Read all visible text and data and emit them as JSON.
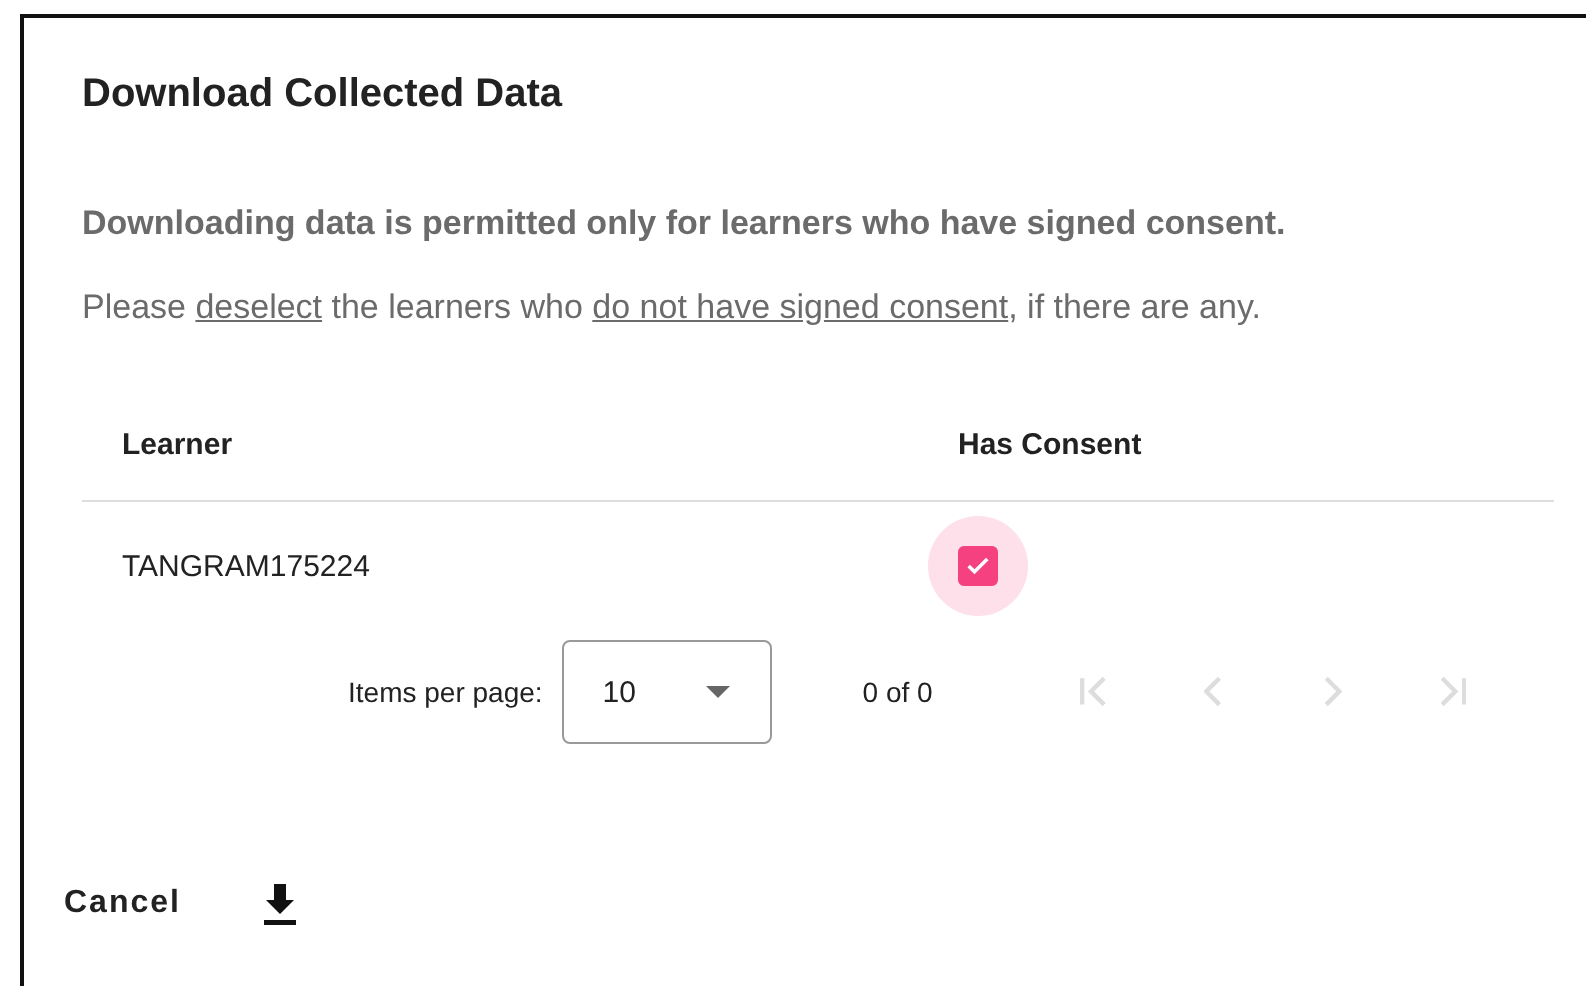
{
  "dialog": {
    "title": "Download Collected Data",
    "notice": "Downloading data is permitted only for learners who have signed consent.",
    "instruction": [
      {
        "text": "Please ",
        "underlined": false
      },
      {
        "text": "deselect",
        "underlined": true
      },
      {
        "text": " the learners who ",
        "underlined": false
      },
      {
        "text": "do not have signed consent",
        "underlined": true
      },
      {
        "text": ", if there are any.",
        "underlined": false
      }
    ]
  },
  "table": {
    "columns": [
      "Learner",
      "Has Consent"
    ],
    "rows": [
      {
        "learner": "TANGRAM175224",
        "checked": true
      }
    ]
  },
  "paginator": {
    "label": "Items per page:",
    "page_size": "10",
    "range": "0 of 0",
    "nav_buttons": [
      {
        "kind": "first",
        "disabled": true
      },
      {
        "kind": "previous",
        "disabled": true
      },
      {
        "kind": "next",
        "disabled": true
      },
      {
        "kind": "last",
        "disabled": true
      }
    ]
  },
  "actions": {
    "cancel": "Cancel"
  }
}
